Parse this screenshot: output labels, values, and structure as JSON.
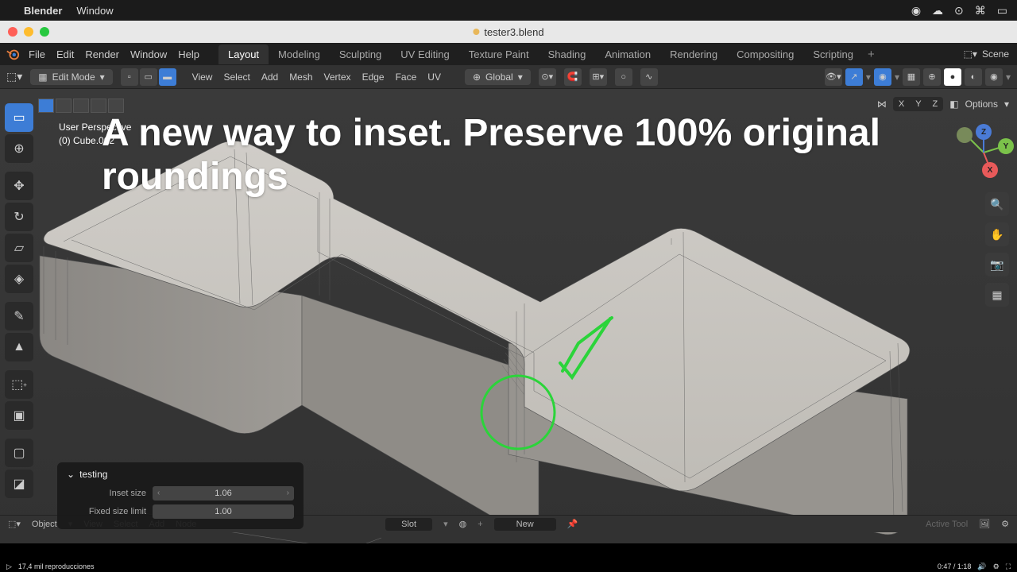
{
  "mac": {
    "app": "Blender",
    "menu": "Window"
  },
  "window": {
    "title": "tester3.blend"
  },
  "file_menu": [
    "File",
    "Edit",
    "Render",
    "Window",
    "Help"
  ],
  "workspaces": [
    "Layout",
    "Modeling",
    "Sculpting",
    "UV Editing",
    "Texture Paint",
    "Shading",
    "Animation",
    "Rendering",
    "Compositing",
    "Scripting"
  ],
  "active_ws": "Layout",
  "scene": {
    "label": "Scene"
  },
  "mode": {
    "label": "Edit Mode"
  },
  "tb_menu": [
    "View",
    "Select",
    "Add",
    "Mesh",
    "Vertex",
    "Edge",
    "Face",
    "UV"
  ],
  "orient": {
    "label": "Global"
  },
  "info": {
    "line1": "User Perspective",
    "line2": "(0) Cube.002"
  },
  "overlay_text": "A new way to inset. Preserve 100% original roundings",
  "axes": {
    "x": "X",
    "y": "Y",
    "z": "Z"
  },
  "options_label": "Options",
  "panel": {
    "title": "testing",
    "rows": [
      {
        "label": "Inset size",
        "value": "1.06",
        "arrows": true
      },
      {
        "label": "Fixed size limit",
        "value": "1.00",
        "arrows": false
      }
    ]
  },
  "bottom": {
    "items": [
      "Object",
      "View",
      "Select",
      "Add",
      "Node"
    ],
    "slot": "Slot",
    "new": "New"
  },
  "play": {
    "repro": "17,4 mil reproducciones",
    "time": "0:47 / 1:18"
  },
  "colors": {
    "red": "#e85a5a",
    "green": "#7bc24a",
    "blue": "#4a7bd6",
    "check": "#2bd43a"
  }
}
